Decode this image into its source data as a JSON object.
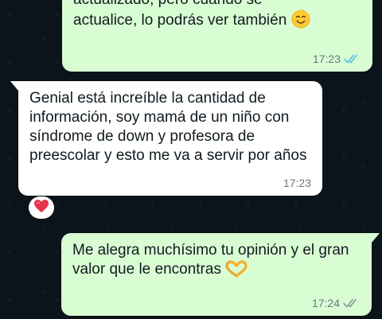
{
  "messages": [
    {
      "direction": "outgoing",
      "line1": "actualizado, pero cuando se",
      "line2": "actualice, lo podrás ver también",
      "emoji": "smiling-face-emoji",
      "time": "17:23",
      "status": "read",
      "status_color": "#53bdeb"
    },
    {
      "direction": "incoming",
      "text": "Genial está increíble la cantidad de información, soy mamá de un niño con síndrome de down y profesora de preescolar y esto me va a servir por años",
      "time": "17:23",
      "reaction": "heart-emoji"
    },
    {
      "direction": "outgoing",
      "text": "Me alegra muchísimo tu opinión y el gran valor que le encontras",
      "emoji": "heart-hands-emoji",
      "time": "17:24",
      "status": "delivered",
      "status_color": "#8696a0"
    }
  ],
  "colors": {
    "background": "#0b141a",
    "outgoing_bubble": "#d9fdd3",
    "incoming_bubble": "#ffffff",
    "text": "#111b21",
    "meta": "#667781"
  }
}
